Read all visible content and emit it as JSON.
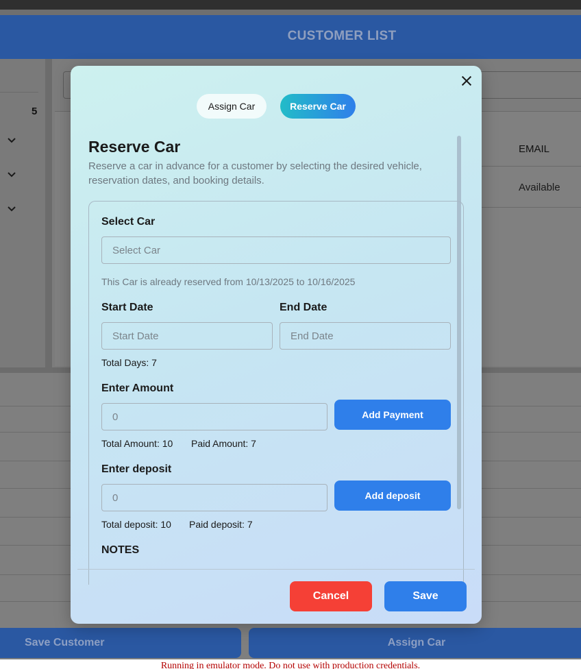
{
  "header": {
    "title": "CUSTOMER LIST"
  },
  "background": {
    "count": "5",
    "table": {
      "email_header": "EMAIL",
      "status_cell": "Available"
    },
    "buttons": {
      "save_customer": "Save Customer",
      "assign_car": "Assign Car"
    }
  },
  "emulator_notice": "Running in emulator mode. Do not use with production credentials.",
  "modal": {
    "tabs": [
      {
        "label": "Assign Car",
        "active": false
      },
      {
        "label": "Reserve Car",
        "active": true
      }
    ],
    "title": "Reserve Car",
    "description": "Reserve a car in advance for a customer by selecting the desired vehicle, reservation dates, and booking details.",
    "form": {
      "select_car": {
        "label": "Select Car",
        "placeholder": "Select Car",
        "value": ""
      },
      "reserved_note": "This Car is already reserved from 10/13/2025 to 10/16/2025",
      "start_date": {
        "label": "Start Date",
        "placeholder": "Start Date",
        "value": ""
      },
      "end_date": {
        "label": "End Date",
        "placeholder": "End Date",
        "value": ""
      },
      "total_days": "Total Days: 7",
      "amount": {
        "label": "Enter Amount",
        "placeholder": "0",
        "value": "",
        "button": "Add Payment"
      },
      "total_amount": "Total Amount: 10",
      "paid_amount": "Paid Amount: 7",
      "deposit": {
        "label": "Enter deposit",
        "placeholder": "0",
        "value": "",
        "button": "Add deposit"
      },
      "total_deposit": "Total deposit: 10",
      "paid_deposit": "Paid deposit: 7",
      "notes_label": "NOTES"
    },
    "footer": {
      "cancel": "Cancel",
      "save": "Save"
    }
  },
  "colors": {
    "primary": "#2f7fea",
    "danger": "#f54036",
    "header": "#2a58a2"
  }
}
